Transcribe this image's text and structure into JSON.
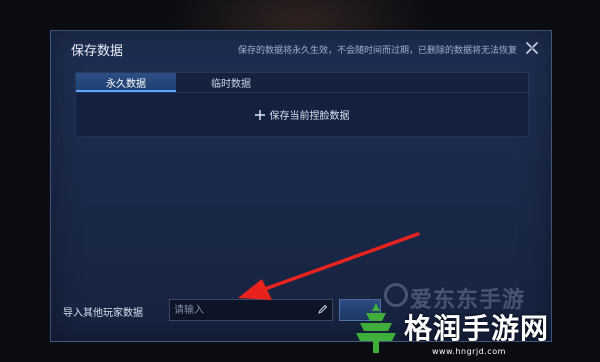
{
  "dialog": {
    "title": "保存数据",
    "note": "保存的数据将永久生效，不会随时间而过期，已删除的数据将无法恢复",
    "close_icon": "close-x-icon"
  },
  "tabs": [
    {
      "label": "永久数据",
      "active": true
    },
    {
      "label": "临时数据",
      "active": false
    }
  ],
  "save_panel": {
    "label": "保存当前捏脸数据",
    "icon": "plus-icon"
  },
  "import": {
    "label": "导入其他玩家数据",
    "placeholder": "请输入",
    "value": "",
    "icon": "pencil-icon"
  },
  "annotation": {
    "arrow_color": "#e8231e"
  },
  "watermarks": {
    "top_text": "爱东东手游",
    "main_text": "格润手游网",
    "url": "www.hngrjd.com",
    "logo_color": "#3fae3a"
  },
  "colors": {
    "dialog_bg": "#1e2e52",
    "tab_active": "#2b4f86",
    "accent": "#5aa4ff"
  }
}
